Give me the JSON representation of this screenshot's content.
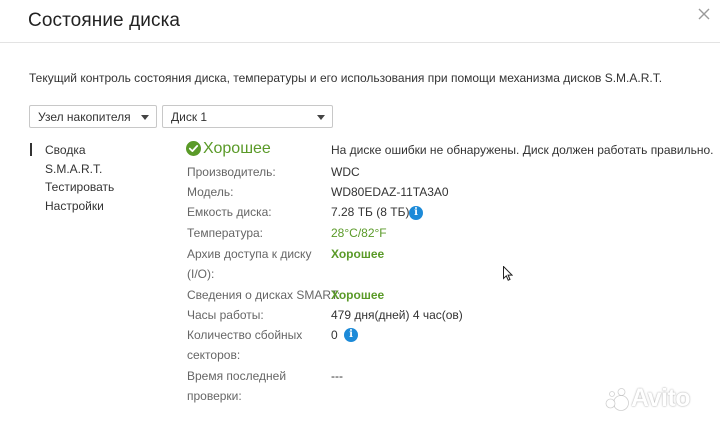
{
  "window": {
    "title": "Состояние диска",
    "close_icon": "close-icon"
  },
  "description": "Текущий контроль состояния диска, температуры и его использования при помощи механизма дисков S.M.A.R.T.",
  "selectors": {
    "node": "Узел накопителя",
    "disk": "Диск 1"
  },
  "nav": {
    "items": [
      {
        "label": "Сводка",
        "active": true
      },
      {
        "label": "S.M.A.R.T.",
        "active": false
      },
      {
        "label": "Тестировать",
        "active": false
      },
      {
        "label": "Настройки",
        "active": false
      }
    ]
  },
  "summary": {
    "status": "Хорошее",
    "status_icon": "check-circle-icon",
    "status_color": "#5a9a28",
    "message": "На диске ошибки не обнаружены. Диск должен работать правильно.",
    "manufacturer_label": "Производитель:",
    "manufacturer_value": "WDC",
    "model_label": "Модель:",
    "model_value": "WD80EDAZ-11TA3A0",
    "capacity_label": "Емкость диска:",
    "capacity_value": "7.28 ТБ (8 ТБ)",
    "temperature_label": "Температура:",
    "temperature_value": "28°C/82°F",
    "io_label_line1": "Архив доступа к диску",
    "io_label_line2": "(I/O):",
    "io_value": "Хорошее",
    "smart_label": "Сведения о дисках SMART:",
    "smart_value": "Хорошее",
    "hours_label": "Часы работы:",
    "hours_value": "479 дня(дней) 4 час(ов)",
    "bad_sectors_label_line1": "Количество сбойных",
    "bad_sectors_label_line2": "секторов:",
    "bad_sectors_value": "0",
    "last_check_label_line1": "Время последней",
    "last_check_label_line2": "проверки:",
    "last_check_value": "---",
    "info_icon_color": "#1c8ad8"
  },
  "watermark": {
    "text": "Avito"
  }
}
